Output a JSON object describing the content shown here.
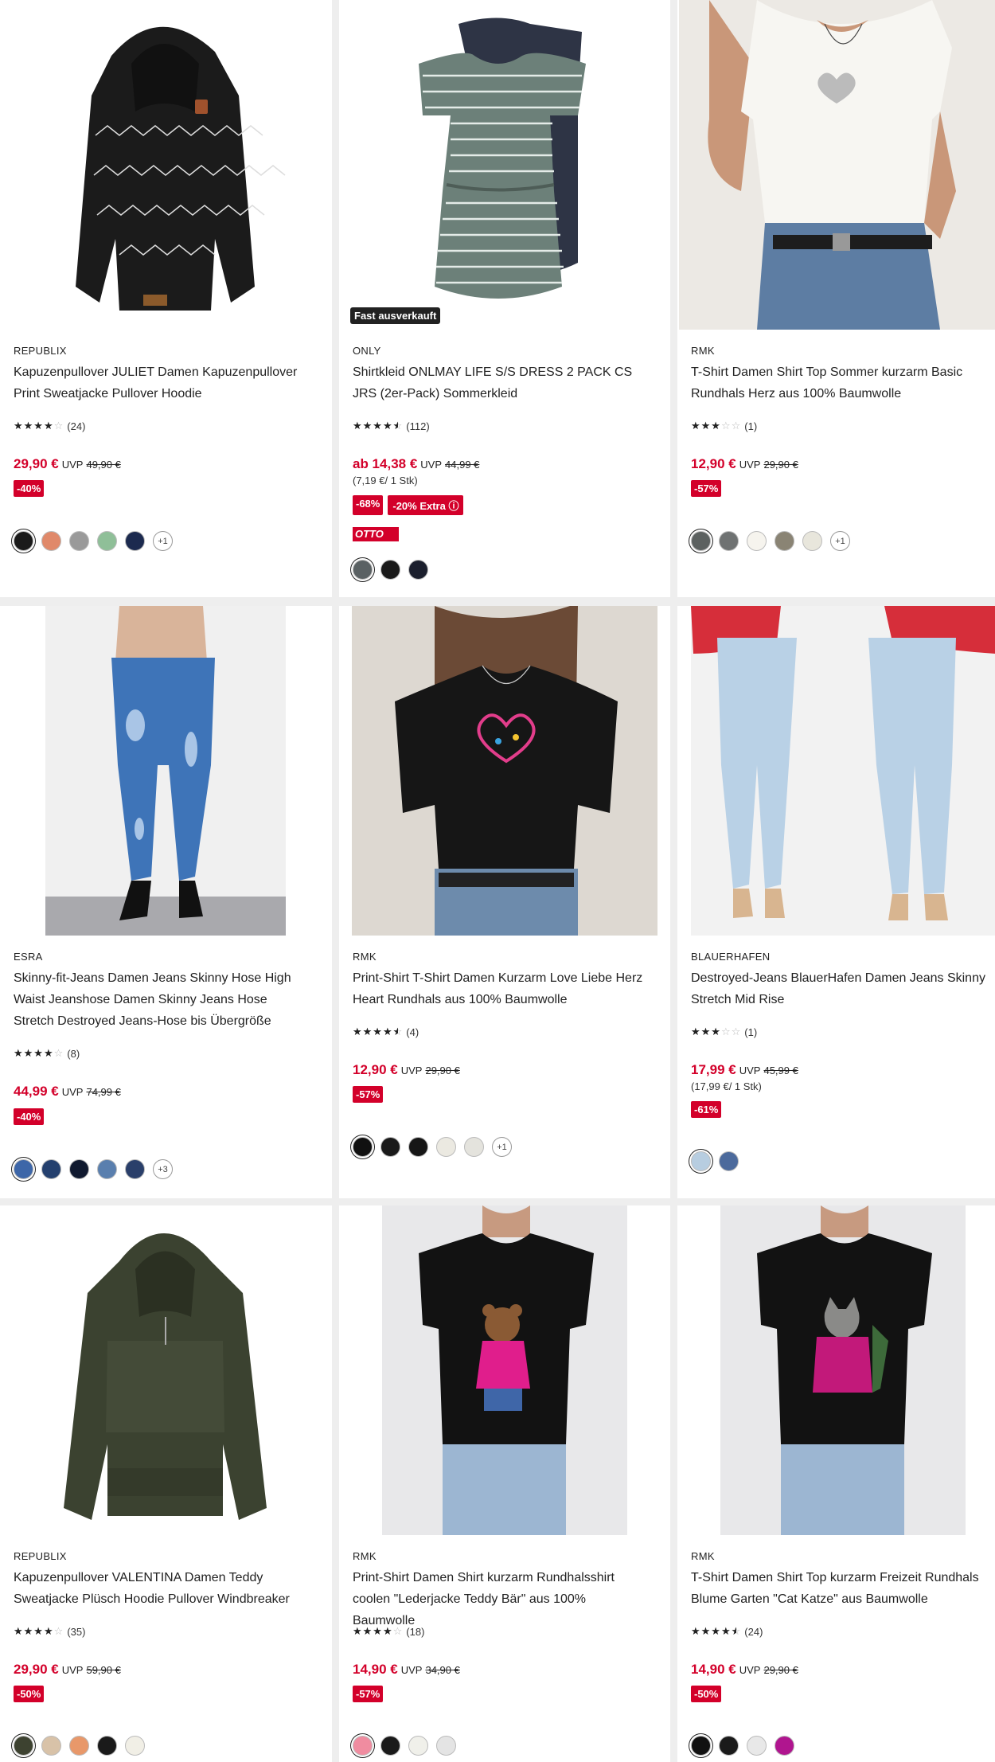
{
  "products": [
    {
      "brand": "REPUBLIX",
      "title": "Kapuzenpullover JULIET Damen Kapuzenpullover Print Sweatjacke Pullover Hoodie",
      "rating": 4,
      "review_count": "(24)",
      "price": "29,90 €",
      "uvp_label": "UVP",
      "uvp": "49,90 €",
      "discount": "-40%",
      "swatches": [
        "#1a1a1a",
        "#e0896a",
        "#9a9a9a",
        "#8fbf98",
        "#1c2a4f"
      ],
      "more": "+1",
      "image_icon": "black-zigzag-hoodie"
    },
    {
      "brand": "ONLY",
      "title": "Shirtkleid ONLMAY LIFE S/S DRESS 2 PACK CS JRS (2er-Pack) Sommerkleid",
      "rating": 4.5,
      "review_count": "(112)",
      "price": "ab 14,38 €",
      "uvp_label": "UVP",
      "uvp": "44,99 €",
      "unit_price": "(7,19 €/ 1 Stk)",
      "discount": "-68%",
      "extra": "-20% Extra ⓘ",
      "badge": "Fast ausverkauft",
      "otto_up": "OTTO UP",
      "swatches": [
        "#5a6163",
        "#1a1a1a",
        "#1b1f2d"
      ],
      "image_icon": "striped-dress"
    },
    {
      "brand": "RMK",
      "title": "T-Shirt Damen Shirt Top Sommer kurzarm Basic Rundhals Herz aus 100% Baumwolle",
      "rating": 3,
      "review_count": "(1)",
      "price": "12,90 €",
      "uvp_label": "UVP",
      "uvp": "29,90 €",
      "discount": "-57%",
      "swatches": [
        "#5c6160",
        "#6f7272",
        "#f6f4ee",
        "#8a8474",
        "#e8e6dc"
      ],
      "more": "+1",
      "image_icon": "white-tshirt"
    },
    {
      "brand": "ESRA",
      "title": "Skinny-fit-Jeans Damen Jeans Skinny Hose High Waist Jeanshose Damen Skinny Jeans Hose Stretch Destroyed Jeans-Hose bis Übergröße",
      "rating": 4,
      "review_count": "(8)",
      "price": "44,99 €",
      "uvp_label": "UVP",
      "uvp": "74,99 €",
      "discount": "-40%",
      "swatches": [
        "#3d66a8",
        "#24406e",
        "#10192f",
        "#5a7fae",
        "#2a3f6a"
      ],
      "more": "+3",
      "image_icon": "skinny-jeans"
    },
    {
      "brand": "RMK",
      "title": "Print-Shirt T-Shirt Damen Kurzarm Love Liebe Herz Heart Rundhals aus 100% Baumwolle",
      "rating": 4.5,
      "review_count": "(4)",
      "price": "12,90 €",
      "uvp_label": "UVP",
      "uvp": "29,90 €",
      "discount": "-57%",
      "swatches": [
        "#111111",
        "#1a1a1a",
        "#161616",
        "#ebe9e1",
        "#e4e3dd"
      ],
      "more": "+1",
      "image_icon": "black-heart-tshirt"
    },
    {
      "brand": "BLAUERHAFEN",
      "title": "Destroyed-Jeans BlauerHafen Damen Jeans Skinny Stretch Mid Rise",
      "rating": 3,
      "review_count": "(1)",
      "price": "17,99 €",
      "uvp_label": "UVP",
      "uvp": "45,99 €",
      "unit_price": "(17,99 €/ 1 Stk)",
      "discount": "-61%",
      "swatches": [
        "#b7cde0",
        "#4c6a9c"
      ],
      "image_icon": "light-jeans"
    },
    {
      "brand": "REPUBLIX",
      "title": "Kapuzenpullover VALENTINA Damen Teddy Sweatjacke Plüsch Hoodie Pullover Windbreaker",
      "rating": 4,
      "review_count": "(35)",
      "price": "29,90 €",
      "uvp_label": "UVP",
      "uvp": "59,90 €",
      "discount": "-50%",
      "swatches": [
        "#3d4230",
        "#d8c2a8",
        "#e8986a",
        "#1a1a1a",
        "#f1efe6"
      ],
      "image_icon": "teddy-hoodie"
    },
    {
      "brand": "RMK",
      "title": "Print-Shirt Damen Shirt kurzarm Rundhalsshirt coolen \"Lederjacke Teddy Bär\" aus 100% Baumwolle",
      "rating": 4,
      "review_count": "(18)",
      "price": "14,90 €",
      "uvp_label": "UVP",
      "uvp": "34,90 €",
      "discount": "-57%",
      "swatches": [
        "#f08ca0",
        "#1a1a1a",
        "#f0f0ea",
        "#e4e4e4"
      ],
      "image_icon": "teddy-bear-tshirt"
    },
    {
      "brand": "RMK",
      "title": "T-Shirt Damen Shirt Top kurzarm Freizeit Rundhals Blume Garten \"Cat Katze\" aus Baumwolle",
      "rating": 4.5,
      "review_count": "(24)",
      "price": "14,90 €",
      "uvp_label": "UVP",
      "uvp": "29,90 €",
      "discount": "-50%",
      "swatches": [
        "#111111",
        "#1a1a1a",
        "#e8e8e8",
        "#b0158f"
      ],
      "image_icon": "cat-tshirt"
    }
  ]
}
